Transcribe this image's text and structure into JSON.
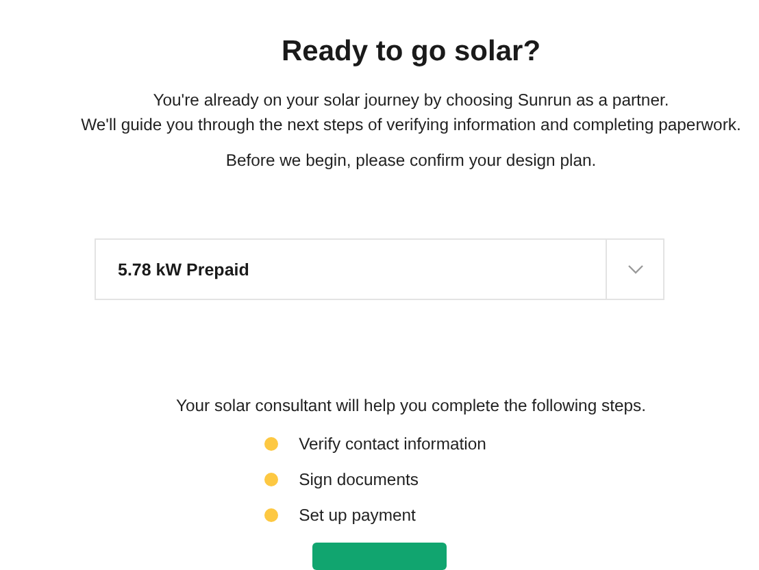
{
  "title": "Ready to go solar?",
  "intro_lines": [
    "You're already on your solar journey by choosing Sunrun as a partner.",
    "We'll guide you through the next steps of verifying information and completing paperwork."
  ],
  "prompt": "Before we begin, please confirm your design plan.",
  "design_plan_dropdown": {
    "value": "5.78 kW Prepaid"
  },
  "steps_intro": "Your solar consultant will help you complete the following steps.",
  "steps": [
    "Verify contact information",
    "Sign documents",
    "Set up payment"
  ]
}
